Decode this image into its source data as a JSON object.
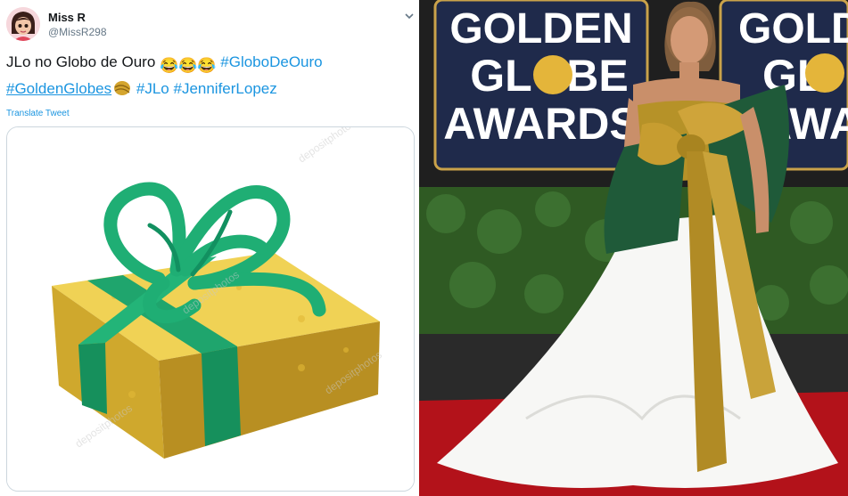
{
  "tweet": {
    "display_name": "Miss R",
    "handle": "@MissR298",
    "text_prefix": "JLo no Globo de Ouro",
    "emojis": [
      "😂",
      "😂",
      "😂"
    ],
    "hashtags": [
      "#GloboDeOuro",
      "#GoldenGlobes",
      "#JLo",
      "#JenniferLopez"
    ],
    "translate_label": "Translate Tweet",
    "watermark": "depositphotos"
  },
  "photo": {
    "sign_lines": [
      "GOLDEN",
      "GL",
      "BE",
      "AWARDS"
    ],
    "sign2_lines": [
      "GOLDEN",
      "GL",
      "AWA"
    ]
  },
  "colors": {
    "link": "#1b95e0",
    "ribbon_green": "#1faa72",
    "gold": "#c9a63a",
    "sign_navy": "#1f2a4b",
    "carpet": "#b3121a"
  }
}
